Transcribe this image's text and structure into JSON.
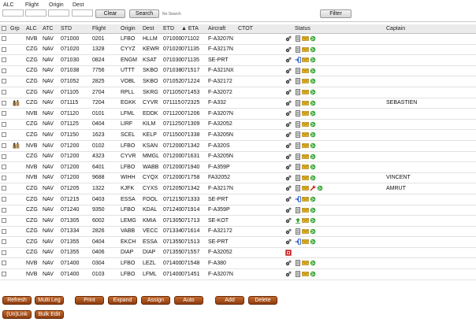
{
  "search": {
    "alc_label": "ALC",
    "flight_label": "Flight",
    "origin_label": "Origin",
    "dest_label": "Dest",
    "clear_label": "Clear",
    "search_label": "Search",
    "no_search_text": "No Search",
    "filter_label": "Filter"
  },
  "table": {
    "headers": {
      "grp": "Grp",
      "alc": "ALC",
      "atc": "ATC",
      "std": "STD",
      "flight": "Flight",
      "origin": "Origin",
      "dest": "Dest",
      "etd": "ETD",
      "eta": "▲ ETA",
      "aircraft": "Aircraft",
      "ctot": "CTOT",
      "status": "Status",
      "captain": "Captain"
    },
    "rows": [
      {
        "grp": false,
        "alc": "NVB",
        "atc": "NAV",
        "std": "071000",
        "flight": "0201",
        "origin": "LFBO",
        "dest": "HLLM",
        "etd": "071000",
        "eta": "071102",
        "aircraft": "F-A3207N",
        "captain": "",
        "status": [
          "gear",
          "doc",
          "envelope",
          "globe"
        ]
      },
      {
        "grp": false,
        "alc": "CZG",
        "atc": "NAV",
        "std": "071020",
        "flight": "1328",
        "origin": "CYYZ",
        "dest": "KEWR",
        "etd": "071020",
        "eta": "071135",
        "aircraft": "F-A3217N",
        "captain": "",
        "status": [
          "gear",
          "doc",
          "envelope",
          "globe"
        ]
      },
      {
        "grp": false,
        "alc": "CZG",
        "atc": "NAV",
        "std": "071030",
        "flight": "0824",
        "origin": "ENGM",
        "dest": "KSAT",
        "etd": "071030",
        "eta": "071135",
        "aircraft": "SE-PRT",
        "captain": "",
        "status": [
          "gear",
          "enter",
          "envelope",
          "globe"
        ]
      },
      {
        "grp": false,
        "alc": "CZG",
        "atc": "NAV",
        "std": "071038",
        "flight": "7756",
        "origin": "UTTT",
        "dest": "SKBO",
        "etd": "071038",
        "eta": "071517",
        "aircraft": "F-A321NX",
        "captain": "",
        "status": [
          "gear",
          "doc",
          "envelope",
          "globe"
        ]
      },
      {
        "grp": false,
        "alc": "CZG",
        "atc": "NAV",
        "std": "071052",
        "flight": "2825",
        "origin": "VOBL",
        "dest": "SKBO",
        "etd": "071052",
        "eta": "071224",
        "aircraft": "F-A32172",
        "captain": "",
        "status": [
          "gear",
          "doc",
          "envelope",
          "globe"
        ]
      },
      {
        "grp": false,
        "alc": "CZG",
        "atc": "NAV",
        "std": "071105",
        "flight": "2704",
        "origin": "RPLL",
        "dest": "SKRG",
        "etd": "071105",
        "eta": "071453",
        "aircraft": "F-A32072",
        "captain": "",
        "status": [
          "gear",
          "doc",
          "envelope",
          "globe"
        ]
      },
      {
        "grp": true,
        "alc": "CZG",
        "atc": "NAV",
        "std": "071115",
        "flight": "7204",
        "origin": "EGKK",
        "dest": "CYVR",
        "etd": "071115",
        "eta": "072325",
        "aircraft": "F-A332",
        "captain": "SEBASTIEN",
        "status": [
          "gear",
          "doc",
          "envelope",
          "globe"
        ]
      },
      {
        "grp": false,
        "alc": "NVB",
        "atc": "NAV",
        "std": "071120",
        "flight": "0101",
        "origin": "LFML",
        "dest": "EDDK",
        "etd": "071120",
        "eta": "071206",
        "aircraft": "F-A3207N",
        "captain": "",
        "status": [
          "gear",
          "doc",
          "envelope",
          "globe"
        ]
      },
      {
        "grp": false,
        "alc": "CZG",
        "atc": "NAV",
        "std": "071125",
        "flight": "0404",
        "origin": "LIRF",
        "dest": "KILM",
        "etd": "071125",
        "eta": "071309",
        "aircraft": "F-A32052",
        "captain": "",
        "status": [
          "gear",
          "doc",
          "envelope",
          "globe"
        ]
      },
      {
        "grp": false,
        "alc": "CZG",
        "atc": "NAV",
        "std": "071150",
        "flight": "1623",
        "origin": "SCEL",
        "dest": "KELP",
        "etd": "071150",
        "eta": "071338",
        "aircraft": "F-A3205N",
        "captain": "",
        "status": [
          "gear",
          "doc",
          "envelope",
          "globe"
        ]
      },
      {
        "grp": true,
        "alc": "NVB",
        "atc": "NAV",
        "std": "071200",
        "flight": "0102",
        "origin": "LFBO",
        "dest": "KSAN",
        "etd": "071200",
        "eta": "071342",
        "aircraft": "F-A320S",
        "captain": "",
        "status": [
          "gear",
          "doc",
          "envelope",
          "globe"
        ]
      },
      {
        "grp": false,
        "alc": "CZG",
        "atc": "NAV",
        "std": "071200",
        "flight": "4323",
        "origin": "CYVR",
        "dest": "MMGL",
        "etd": "071200",
        "eta": "071631",
        "aircraft": "F-A3205N",
        "captain": "",
        "status": [
          "gear",
          "doc",
          "envelope",
          "globe"
        ]
      },
      {
        "grp": false,
        "alc": "NVB",
        "atc": "NAV",
        "std": "071200",
        "flight": "6401",
        "origin": "LFBO",
        "dest": "WABB",
        "etd": "071200",
        "eta": "071940",
        "aircraft": "F-A359P",
        "captain": "",
        "status": [
          "gear",
          "doc",
          "envelope",
          "globe"
        ]
      },
      {
        "grp": false,
        "alc": "NVB",
        "atc": "NAV",
        "std": "071200",
        "flight": "9688",
        "origin": "WIHH",
        "dest": "CYQX",
        "etd": "071200",
        "eta": "071758",
        "aircraft": "FA32052",
        "captain": "VINCENT",
        "status": [
          "gear",
          "doc",
          "envelope",
          "globe"
        ]
      },
      {
        "grp": false,
        "alc": "CZG",
        "atc": "NAV",
        "std": "071205",
        "flight": "1322",
        "origin": "KJFK",
        "dest": "CYXS",
        "etd": "071205",
        "eta": "071342",
        "aircraft": "F-A3217N",
        "captain": "AMRUT",
        "status": [
          "gear",
          "doc",
          "envelope",
          "wrench",
          "globe"
        ]
      },
      {
        "grp": false,
        "alc": "CZG",
        "atc": "NAV",
        "std": "071215",
        "flight": "0403",
        "origin": "ESSA",
        "dest": "FOOL",
        "etd": "071215",
        "eta": "071333",
        "aircraft": "SE-PRT",
        "captain": "",
        "status": [
          "gear",
          "enter",
          "envelope",
          "globe"
        ]
      },
      {
        "grp": false,
        "alc": "CZG",
        "atc": "NAV",
        "std": "071240",
        "flight": "9350",
        "origin": "LFBO",
        "dest": "KDAL",
        "etd": "071240",
        "eta": "071914",
        "aircraft": "F-A359P",
        "captain": "",
        "status": [
          "gear",
          "doc",
          "envelope",
          "globe"
        ]
      },
      {
        "grp": false,
        "alc": "CZG",
        "atc": "NAV",
        "std": "071305",
        "flight": "6002",
        "origin": "LEMG",
        "dest": "KMIA",
        "etd": "071305",
        "eta": "071713",
        "aircraft": "SE-KOT",
        "captain": "",
        "status": [
          "gear",
          "upload",
          "envelope",
          "globe"
        ]
      },
      {
        "grp": false,
        "alc": "CZG",
        "atc": "NAV",
        "std": "071334",
        "flight": "2826",
        "origin": "VABB",
        "dest": "VECC",
        "etd": "071334",
        "eta": "071614",
        "aircraft": "F-A32172",
        "captain": "",
        "status": [
          "gear",
          "doc",
          "envelope",
          "globe"
        ]
      },
      {
        "grp": false,
        "alc": "CZG",
        "atc": "NAV",
        "std": "071355",
        "flight": "0404",
        "origin": "EKCH",
        "dest": "ESSA",
        "etd": "071355",
        "eta": "071513",
        "aircraft": "SE-PRT",
        "captain": "",
        "status": [
          "gear",
          "enter",
          "envelope",
          "globe"
        ]
      },
      {
        "grp": false,
        "alc": "CZG",
        "atc": "NAV",
        "std": "071355",
        "flight": "0406",
        "origin": "DIAP",
        "dest": "DIAP",
        "etd": "071355",
        "eta": "071557",
        "aircraft": "F-A32052",
        "captain": "",
        "status": [
          "redbox"
        ]
      },
      {
        "grp": false,
        "alc": "NVB",
        "atc": "NAV",
        "std": "071400",
        "flight": "0304",
        "origin": "LFBO",
        "dest": "LEZL",
        "etd": "071400",
        "eta": "071548",
        "aircraft": "F-A380",
        "captain": "",
        "status": [
          "gear",
          "doc",
          "envelope",
          "globe"
        ]
      },
      {
        "grp": false,
        "alc": "NVB",
        "atc": "NAV",
        "std": "071400",
        "flight": "0103",
        "origin": "LFBO",
        "dest": "LFML",
        "etd": "071400",
        "eta": "071451",
        "aircraft": "F-A3207N",
        "captain": "",
        "status": [
          "gear",
          "doc",
          "envelope",
          "globe"
        ]
      }
    ]
  },
  "footer": {
    "refresh": "Refresh",
    "multi_leg": "Multi Leg",
    "print": "Print",
    "expand": "Expand",
    "assign": "Assign",
    "auto": "Auto",
    "add": "Add",
    "delete": "Delete",
    "unlink": "(Un)Link",
    "bulk_edit": "Bulk Edit"
  },
  "colors": {
    "brown_button": "#a04c1a",
    "header_bg": "#ebebeb"
  }
}
